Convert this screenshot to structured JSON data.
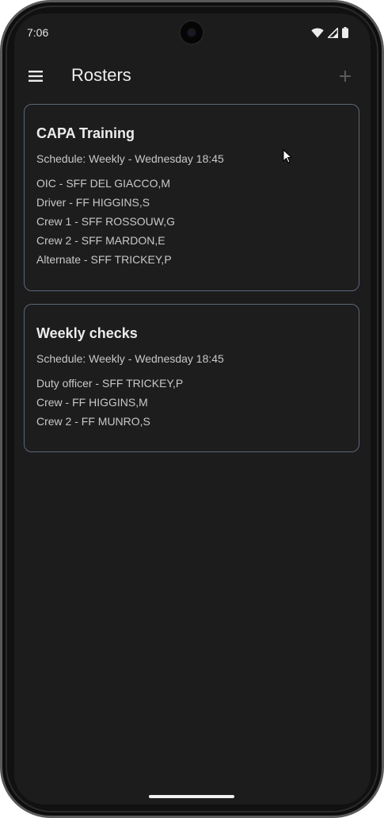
{
  "status_bar": {
    "time": "7:06"
  },
  "app_bar": {
    "title": "Rosters",
    "menu_icon": "menu-icon",
    "add_icon": "add-icon"
  },
  "rosters": [
    {
      "title": "CAPA Training",
      "schedule": "Schedule: Weekly - Wednesday 18:45",
      "members": [
        "OIC - SFF DEL GIACCO,M",
        "Driver - FF HIGGINS,S",
        "Crew 1 - SFF ROSSOUW,G",
        "Crew 2 - SFF MARDON,E",
        "Alternate - SFF TRICKEY,P"
      ]
    },
    {
      "title": "Weekly checks",
      "schedule": "Schedule: Weekly - Wednesday 18:45",
      "members": [
        "Duty officer - SFF TRICKEY,P",
        "Crew - FF HIGGINS,M",
        "Crew 2 - FF MUNRO,S"
      ]
    }
  ],
  "colors": {
    "background": "#1c1c1c",
    "card_border": "#5b6778",
    "text_primary": "#ececec",
    "text_secondary": "#c8c8c8",
    "disabled_icon": "#5a5a5a"
  }
}
